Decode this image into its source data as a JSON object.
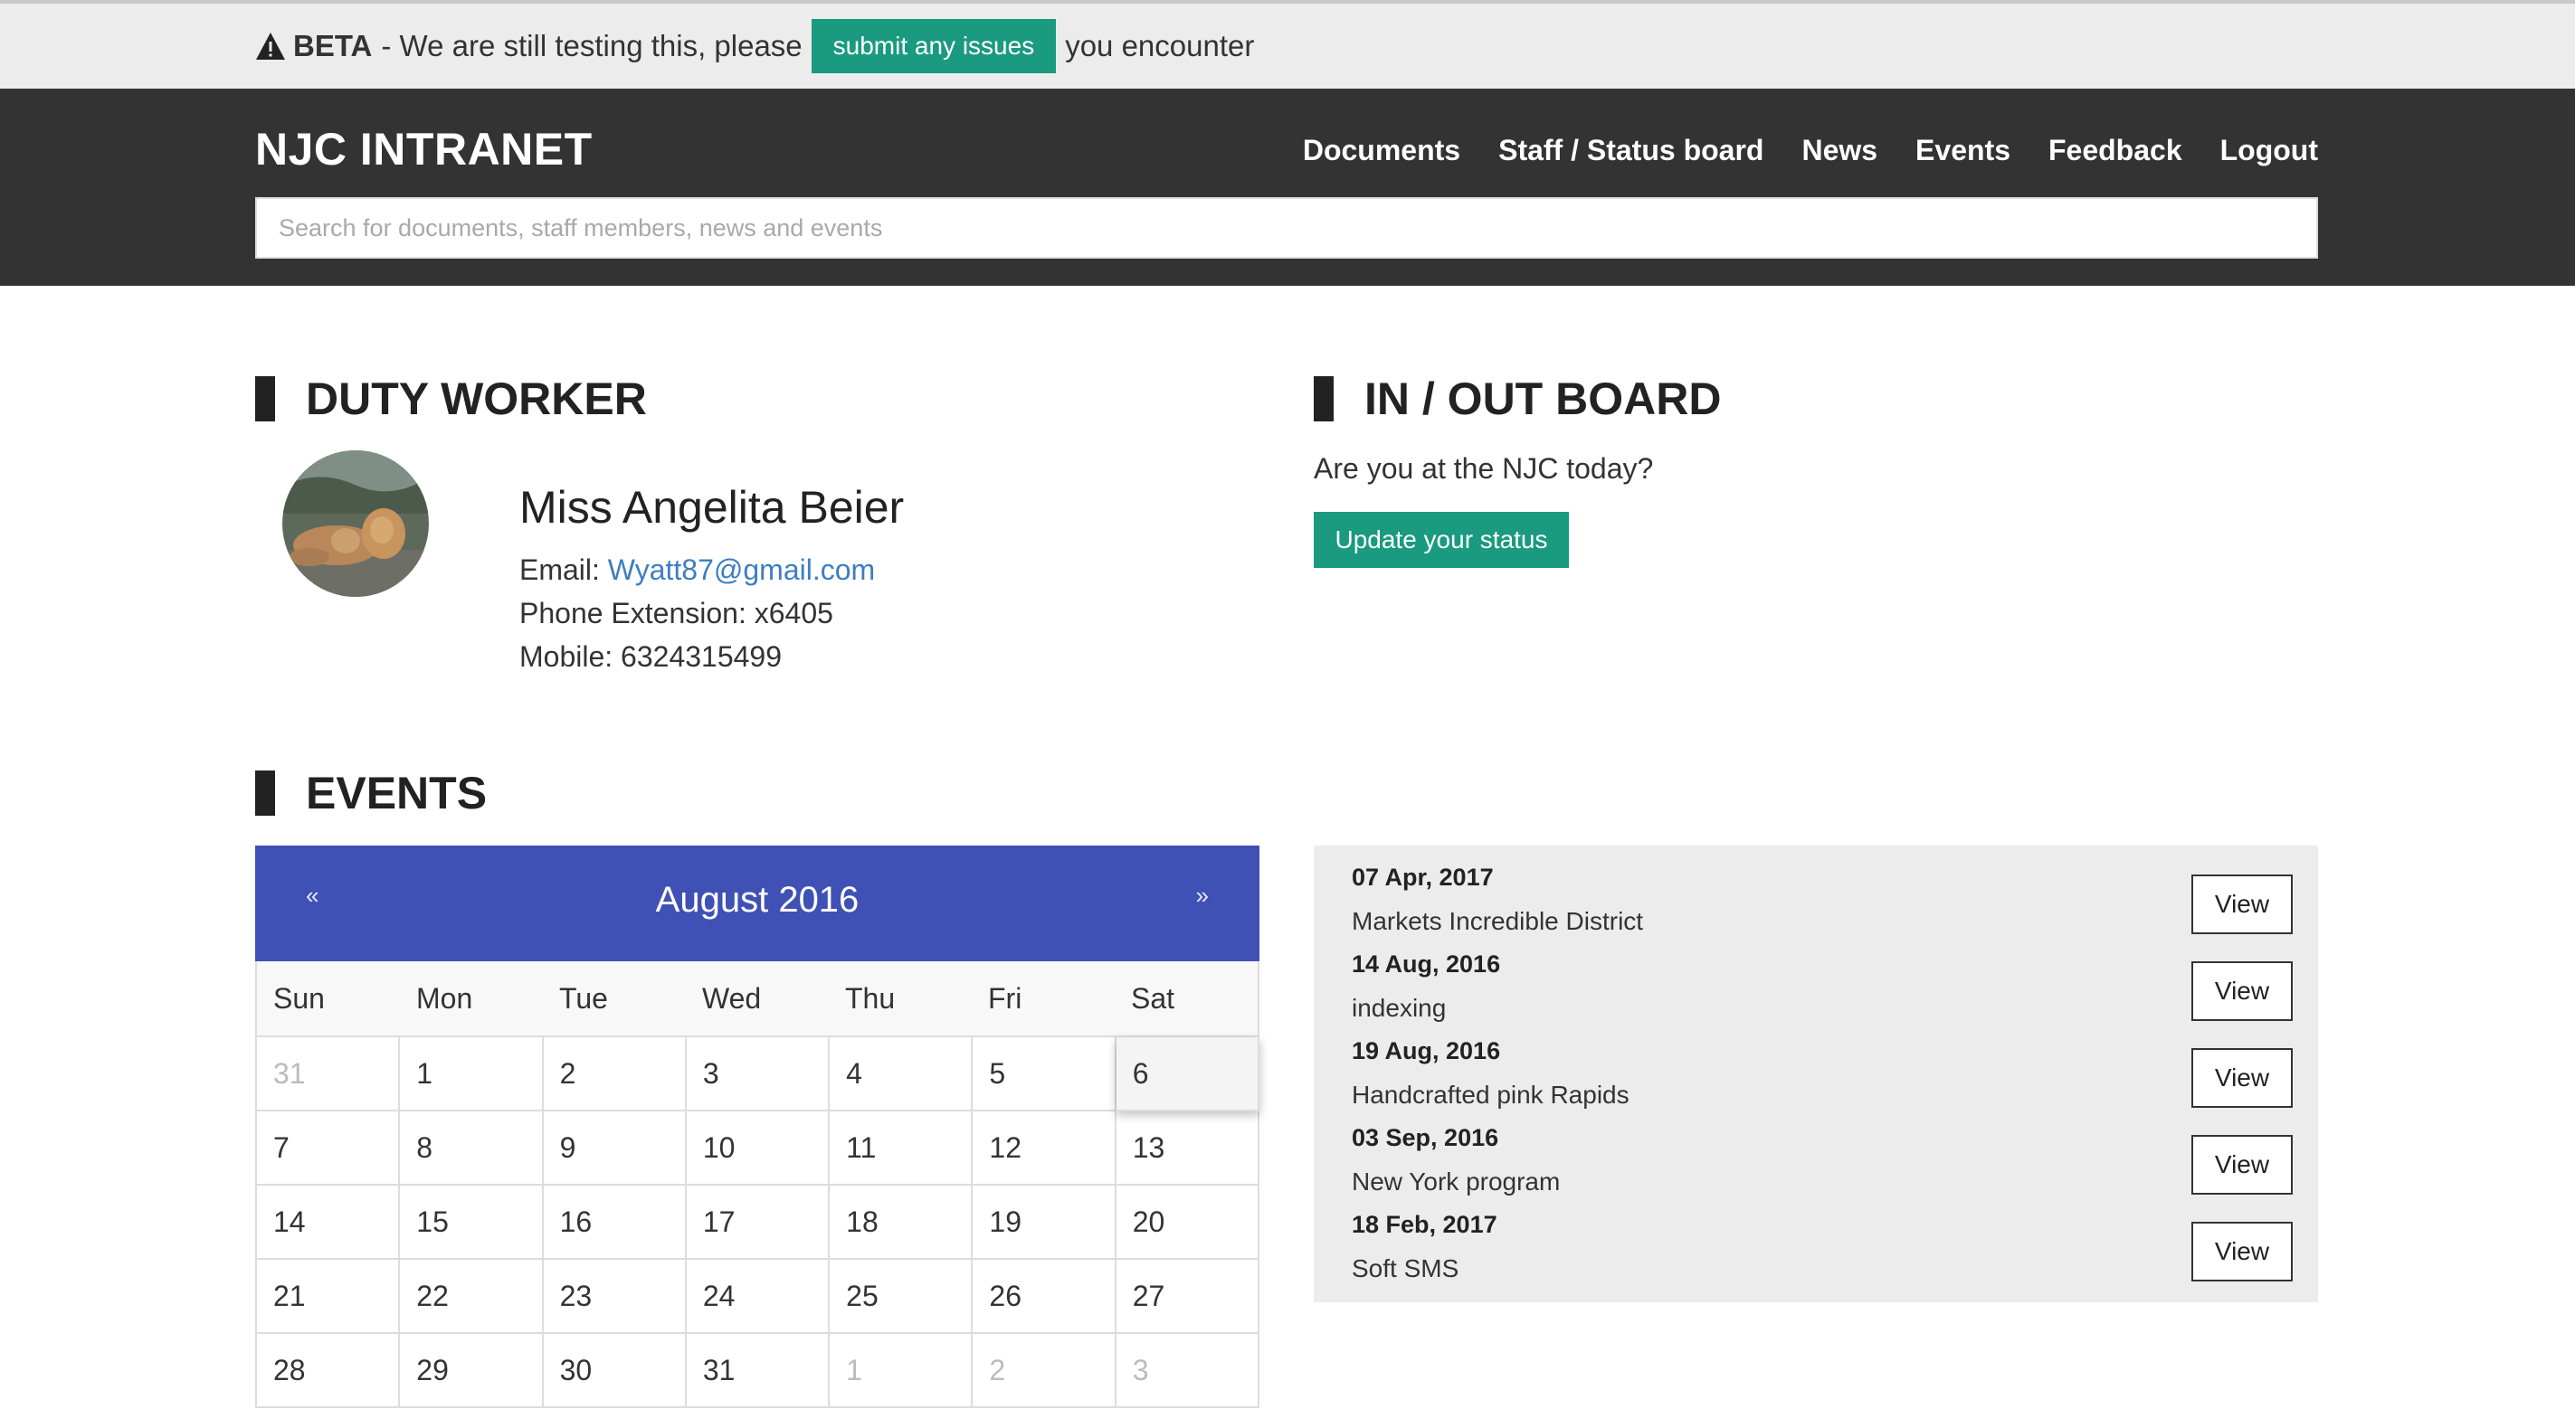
{
  "beta": {
    "strong": "BETA",
    "text_before": "- We are still testing this, please",
    "button": "submit any issues",
    "text_after": "you encounter"
  },
  "header": {
    "brand": "NJC INTRANET",
    "nav": [
      "Documents",
      "Staff / Status board",
      "News",
      "Events",
      "Feedback",
      "Logout"
    ],
    "search_placeholder": "Search for documents, staff members, news and events"
  },
  "duty": {
    "title": "DUTY WORKER",
    "name": "Miss Angelita Beier",
    "email_label": "Email:",
    "email": "Wyatt87@gmail.com",
    "phone": "Phone Extension: x6405",
    "mobile": "Mobile: 6324315499"
  },
  "inout": {
    "title": "IN / OUT BOARD",
    "question": "Are you at the NJC today?",
    "button": "Update your status"
  },
  "events": {
    "title": "EVENTS",
    "calendar": {
      "prev": "«",
      "next": "»",
      "month": "August 2016",
      "days": [
        "Sun",
        "Mon",
        "Tue",
        "Wed",
        "Thu",
        "Fri",
        "Sat"
      ],
      "weeks": [
        [
          "31",
          "1",
          "2",
          "3",
          "4",
          "5",
          "6"
        ],
        [
          "7",
          "8",
          "9",
          "10",
          "11",
          "12",
          "13"
        ],
        [
          "14",
          "15",
          "16",
          "17",
          "18",
          "19",
          "20"
        ],
        [
          "21",
          "22",
          "23",
          "24",
          "25",
          "26",
          "27"
        ],
        [
          "28",
          "29",
          "30",
          "31",
          "1",
          "2",
          "3"
        ]
      ]
    },
    "list": [
      {
        "date": "07 Apr, 2017",
        "name": "Markets Incredible District",
        "button": "View"
      },
      {
        "date": "14 Aug, 2016",
        "name": "indexing",
        "button": "View"
      },
      {
        "date": "19 Aug, 2016",
        "name": "Handcrafted pink Rapids",
        "button": "View"
      },
      {
        "date": "03 Sep, 2016",
        "name": "New York program",
        "button": "View"
      },
      {
        "date": "18 Feb, 2017",
        "name": "Soft SMS",
        "button": "View"
      }
    ]
  },
  "colors": {
    "accent": "#1a9a7f",
    "header_bg": "#333333",
    "calendar_header": "#3f51b5",
    "link": "#3c7ec2"
  }
}
